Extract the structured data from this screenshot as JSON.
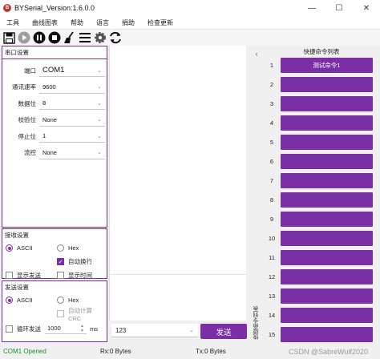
{
  "window": {
    "title": "BYSerial_Version:1.6.0.0",
    "icon": "app-logo-icon"
  },
  "menu": [
    "工具",
    "曲线图表",
    "帮助",
    "语言",
    "捐助",
    "检查更新"
  ],
  "toolbar": [
    "save-icon",
    "play-icon",
    "pause-icon",
    "stop-icon",
    "clean-icon",
    "list-icon",
    "gear-icon",
    "refresh-icon"
  ],
  "serial_settings": {
    "title": "串口设置",
    "port": {
      "label": "端口",
      "value": "COM1"
    },
    "baud": {
      "label": "通讯速率",
      "value": "9600"
    },
    "data_bits": {
      "label": "数据位",
      "value": "8"
    },
    "parity": {
      "label": "校验位",
      "value": "None"
    },
    "stop_bits": {
      "label": "停止位",
      "value": "1"
    },
    "flow": {
      "label": "流控",
      "value": "None"
    }
  },
  "receive_settings": {
    "title": "接收设置",
    "ascii": "ASCII",
    "hex": "Hex",
    "auto_newline": "自动换行",
    "show_send": "显示发送",
    "show_time": "显示时间"
  },
  "send_settings": {
    "title": "发送设置",
    "ascii": "ASCII",
    "hex": "Hex",
    "auto_crc": "自动计算CRC",
    "loop_send": "循环发送",
    "interval": "1000",
    "unit": "ms"
  },
  "send_box": {
    "value": "123",
    "button": "发送"
  },
  "quick_panel": {
    "title": "快捷命令列表",
    "side_label": "快捷命令列表",
    "commands": [
      {
        "num": "1",
        "label": "测试命令1"
      },
      {
        "num": "2",
        "label": ""
      },
      {
        "num": "3",
        "label": ""
      },
      {
        "num": "4",
        "label": ""
      },
      {
        "num": "5",
        "label": ""
      },
      {
        "num": "6",
        "label": ""
      },
      {
        "num": "7",
        "label": ""
      },
      {
        "num": "8",
        "label": ""
      },
      {
        "num": "9",
        "label": ""
      },
      {
        "num": "10",
        "label": ""
      },
      {
        "num": "11",
        "label": ""
      },
      {
        "num": "12",
        "label": ""
      },
      {
        "num": "13",
        "label": ""
      },
      {
        "num": "14",
        "label": ""
      },
      {
        "num": "15",
        "label": ""
      }
    ]
  },
  "status": {
    "connection": "COM1 Opened",
    "rx": "Rx:0 Bytes",
    "tx": "Tx:0 Bytes",
    "watermark": "CSDN @SabreWulf2020"
  },
  "colors": {
    "accent": "#7b2fa6",
    "connected": "#1a8f2e"
  }
}
